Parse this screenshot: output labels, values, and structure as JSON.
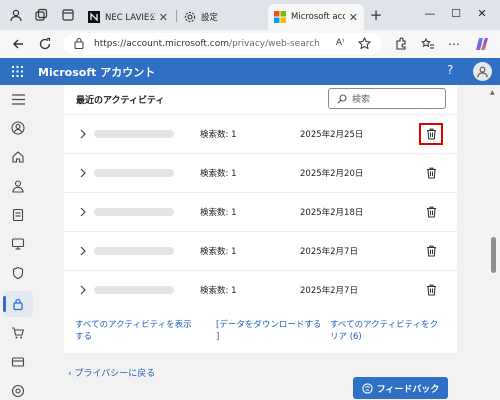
{
  "browser": {
    "tabs": [
      {
        "title": "NEC LAVIE公式"
      },
      {
        "title": "設定"
      },
      {
        "title": "Microsoft accou"
      }
    ],
    "new_tab_label": "+",
    "url_host": "https://account.microsoft.com",
    "url_path": "/privacy/web-search",
    "reading_mode_label": "A⁾",
    "window_controls": {
      "minimize": "—",
      "maximize": "☐",
      "close": "✕"
    }
  },
  "header": {
    "brand": "Microsoft アカウント",
    "help": "?"
  },
  "activity": {
    "title": "最近のアクティビティ",
    "search_placeholder": "検索",
    "rows": [
      {
        "count": "検索数: 1",
        "date": "2025年2月25日",
        "highlighted": true
      },
      {
        "count": "検索数: 1",
        "date": "2025年2月20日",
        "highlighted": false
      },
      {
        "count": "検索数: 1",
        "date": "2025年2月18日",
        "highlighted": false
      },
      {
        "count": "検索数: 1",
        "date": "2025年2月7日",
        "highlighted": false
      },
      {
        "count": "検索数: 1",
        "date": "2025年2月7日",
        "highlighted": false
      }
    ],
    "links": {
      "view_all_1": "すべてのアクティビティを表示",
      "view_all_2": "する",
      "download_1": "[データをダウンロードする",
      "download_2": "]",
      "clear_1": "すべてのアクティビティをク",
      "clear_2": "リア (6)"
    }
  },
  "footer": {
    "back": "プライバシーに戻る",
    "feedback": "フィードバック"
  },
  "colors": {
    "accent": "#2f6fc4",
    "link": "#1c5fb4",
    "highlight_box": "#e00000"
  }
}
